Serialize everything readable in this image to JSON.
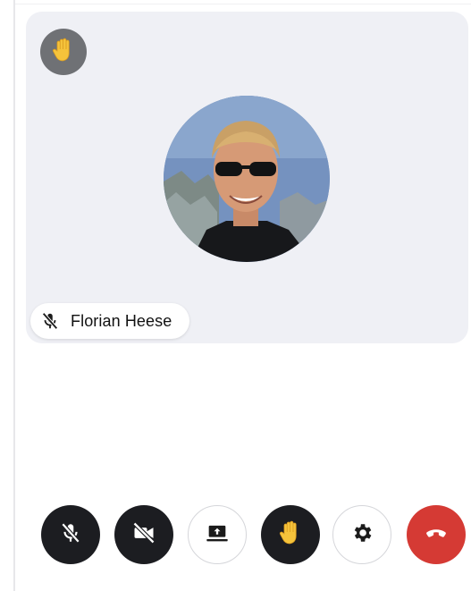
{
  "participant": {
    "name": "Florian Heese",
    "muted": true,
    "hand_raised": true
  },
  "controls": [
    {
      "id": "mic",
      "icon": "mic-off-icon",
      "state": "off"
    },
    {
      "id": "camera",
      "icon": "videocam-off-icon",
      "state": "off"
    },
    {
      "id": "share",
      "icon": "screen-share-icon",
      "state": "inactive"
    },
    {
      "id": "raise-hand",
      "icon": "raised-hand-icon",
      "state": "active"
    },
    {
      "id": "settings",
      "icon": "gear-icon",
      "state": "idle"
    },
    {
      "id": "hangup",
      "icon": "phone-hangup-icon",
      "state": "idle"
    }
  ],
  "colors": {
    "tile_background": "#eff0f5",
    "dark_button": "#1c1d21",
    "hangup_red": "#d53a34",
    "hand_emoji": "#f5c33b",
    "badge_gray": "#6f7175"
  }
}
